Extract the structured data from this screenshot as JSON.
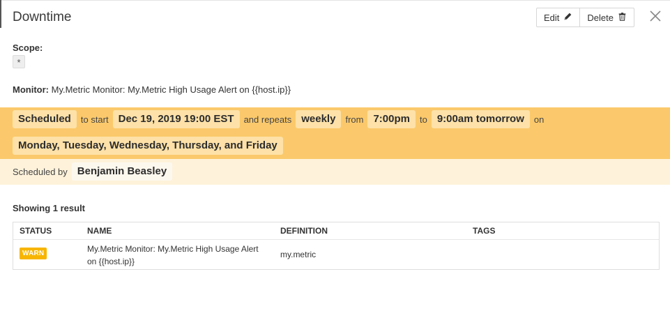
{
  "panel": {
    "title": "Downtime",
    "edit_label": "Edit",
    "delete_label": "Delete",
    "icons": {
      "edit": "pencil-icon",
      "delete": "trash-icon",
      "close": "close-icon"
    }
  },
  "scope": {
    "label": "Scope:",
    "value": "*"
  },
  "monitor": {
    "label": "Monitor:",
    "value": "My.Metric Monitor: My.Metric High Usage Alert on {{host.ip}}"
  },
  "schedule": {
    "status": "Scheduled",
    "t_to_start": "to start",
    "start": "Dec 19, 2019 19:00 EST",
    "t_and_repeats": "and repeats",
    "repeat": "weekly",
    "t_from": "from",
    "from_time": "7:00pm",
    "t_to": "to",
    "to_time": "9:00am tomorrow",
    "t_on": "on",
    "days": "Monday, Tuesday, Wednesday, Thursday, and Friday",
    "scheduled_by_label": "Scheduled by",
    "scheduled_by": "Benjamin Beasley",
    "colors": {
      "band": "#fbc96b",
      "chip": "#fde1a8",
      "by_band": "#fef2da"
    }
  },
  "results": {
    "summary": "Showing 1 result",
    "columns": [
      "STATUS",
      "NAME",
      "DEFINITION",
      "TAGS"
    ],
    "rows": [
      {
        "status": "WARN",
        "name": "My.Metric Monitor: My.Metric High Usage Alert on {{host.ip}}",
        "definition": "my.metric",
        "tags": ""
      }
    ],
    "colors": {
      "warn": "#f7b500"
    }
  }
}
